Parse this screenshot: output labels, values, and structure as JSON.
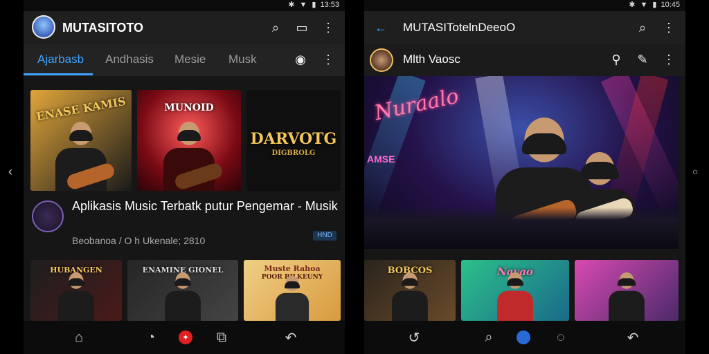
{
  "left_screen": {
    "status_time": "13:53",
    "app_title": "MUTASITOTO",
    "tabs": [
      {
        "label": "Ajarbasb",
        "active": true
      },
      {
        "label": "Andhasis",
        "active": false
      },
      {
        "label": "Mesie",
        "active": false
      },
      {
        "label": "Musk",
        "active": false
      }
    ],
    "thumbnails": [
      {
        "caption": "ENASE KAMIS",
        "colors": [
          "#e0a53a",
          "#1a1a1a"
        ]
      },
      {
        "caption": "MUNOID",
        "colors": [
          "#d8283a",
          "#3a0a10"
        ]
      },
      {
        "caption": "DARVOTG",
        "subcaption": "DIGBROLG",
        "colors": [
          "#0f0f0f",
          "#222"
        ]
      }
    ],
    "video_title": "Aplikasis Music Terbatk putur Pengemar - Musik",
    "video_meta": "Beobanoa / O h Ukenale; 2810",
    "badge": "HND",
    "bottom_thumbnails": [
      {
        "caption": "HUBANGEN",
        "colors": [
          "#1e1e1e",
          "#4a1a1a"
        ]
      },
      {
        "caption": "ENAMINE GIONEL",
        "colors": [
          "#262626",
          "#444"
        ]
      },
      {
        "caption": "Muste Rahoa",
        "subcaption": "POOR BILKEUNY",
        "colors": [
          "#f0cf86",
          "#d89a3e"
        ]
      }
    ]
  },
  "right_screen": {
    "status_time": "10:45",
    "app_title": "MUTASITotelnDeeoO",
    "channel_name": "Mlth Vaosc",
    "player_title": "Nuraalo",
    "player_side_text": "AMSE",
    "bottom_thumbnails": [
      {
        "caption": "BOBCOS",
        "colors": [
          "#2a241c",
          "#6a4a2a"
        ]
      },
      {
        "caption": "Navao",
        "colors": [
          "#2cc08a",
          "#1a6a8a"
        ]
      },
      {
        "caption": "",
        "colors": [
          "#d84ab0",
          "#4a2a6a"
        ]
      }
    ]
  }
}
